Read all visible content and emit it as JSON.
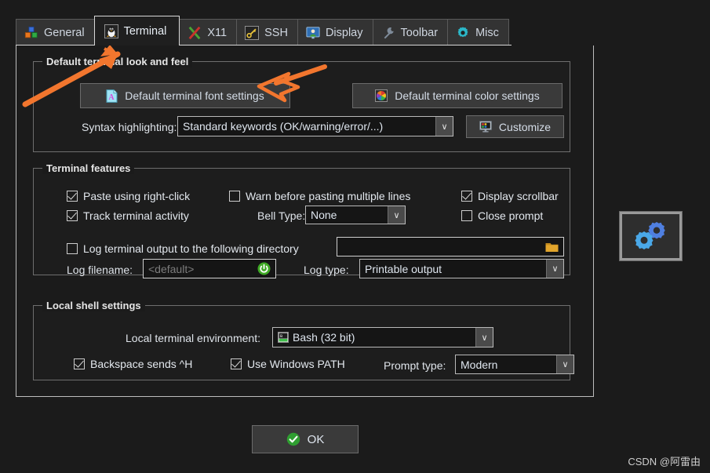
{
  "tabs": [
    {
      "label": "General",
      "icon": "blocks-icon",
      "active": false
    },
    {
      "label": "Terminal",
      "icon": "penguin-icon",
      "active": true
    },
    {
      "label": "X11",
      "icon": "x-icon",
      "active": false
    },
    {
      "label": "SSH",
      "icon": "key-icon",
      "active": false
    },
    {
      "label": "Display",
      "icon": "monitor-user-icon",
      "active": false
    },
    {
      "label": "Toolbar",
      "icon": "wrench-icon",
      "active": false
    },
    {
      "label": "Misc",
      "icon": "gear-icon",
      "active": false
    }
  ],
  "look_and_feel": {
    "legend": "Default terminal look and feel",
    "font_button": "Default terminal font settings",
    "font_button_icon": "font-page-icon",
    "color_button": "Default terminal color settings",
    "color_button_icon": "color-wheel-icon",
    "syntax_label": "Syntax highlighting:",
    "syntax_value": "Standard keywords (OK/warning/error/...)",
    "customize_button": "Customize",
    "customize_icon": "monitor-palette-icon"
  },
  "terminal_features": {
    "legend": "Terminal features",
    "paste_right_click": {
      "label": "Paste using right-click",
      "checked": true
    },
    "track_activity": {
      "label": "Track terminal activity",
      "checked": true
    },
    "warn_paste": {
      "label": "Warn before pasting multiple lines",
      "checked": false
    },
    "display_scrollbar": {
      "label": "Display scrollbar",
      "checked": true
    },
    "close_prompt": {
      "label": "Close prompt",
      "checked": false
    },
    "bell_label": "Bell Type:",
    "bell_value": "None",
    "log_checkbox": {
      "label": "Log terminal output to the following directory",
      "checked": false
    },
    "log_dir_value": "",
    "log_dir_icon": "folder-icon",
    "log_filename_label": "Log filename:",
    "log_filename_placeholder": "<default>",
    "log_filename_reset_icon": "reset-icon",
    "log_type_label": "Log type:",
    "log_type_value": "Printable output"
  },
  "local_shell": {
    "legend": "Local shell settings",
    "env_label": "Local terminal environment:",
    "env_value": "Bash (32 bit)",
    "env_icon": "bash-icon",
    "backspace": {
      "label": "Backspace sends ^H",
      "checked": true
    },
    "win_path": {
      "label": "Use Windows PATH",
      "checked": true
    },
    "prompt_label": "Prompt type:",
    "prompt_value": "Modern"
  },
  "footer": {
    "ok_label": "OK",
    "ok_icon": "check-circle-icon",
    "watermark": "CSDN @阿雷由"
  },
  "side_icon": {
    "name": "two-gears-icon"
  },
  "colors": {
    "background": "#1b1b1b",
    "accent_arrow": "#f2762e",
    "text": "#e3e8ee",
    "border": "#bdbdbd"
  }
}
